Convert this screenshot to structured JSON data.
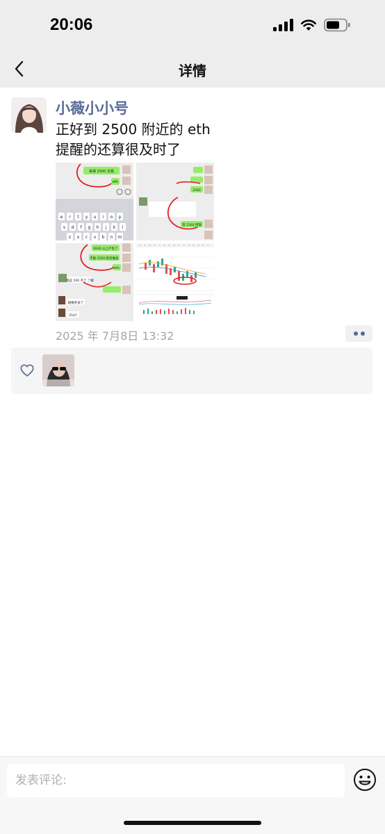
{
  "status_bar": {
    "time": "20:06"
  },
  "nav": {
    "title": "详情",
    "back_icon": "chevron-left-icon"
  },
  "post": {
    "author": "小薇小小号",
    "text_lines": [
      "正好到 2500 附近的 eth",
      "提醒的还算很及时了"
    ],
    "time": "2025 年 7月8日 13:32",
    "images": [
      {
        "name": "chat-screenshot-keyboard",
        "bubbles": [
          "来得 2500 交易",
          "eth"
        ],
        "keys": [
          "e",
          "r",
          "t",
          "y",
          "u",
          "i",
          "o",
          "p",
          "s",
          "d",
          "f",
          "g",
          "h",
          "j",
          "k",
          "l",
          "z",
          "x",
          "c",
          "v",
          "b",
          "n",
          "m"
        ]
      },
      {
        "name": "chat-screenshot-2",
        "bubbles": [
          "2560",
          "等 2500 回落"
        ]
      },
      {
        "name": "chat-screenshot-3",
        "bubbles": [
          "2640 以上产生了",
          "不能 2500 附近做多",
          "eth"
        ],
        "replies": [
          "到这 500 点了 了解",
          "刚要开多了",
          "2547"
        ]
      },
      {
        "name": "eth-price-chart",
        "bubbles": []
      }
    ]
  },
  "likes": {
    "icon": "heart-outline-icon",
    "count_shown": 1
  },
  "comment": {
    "placeholder": "发表评论:"
  },
  "colors": {
    "link": "#576b95",
    "bar_bg": "#ededed",
    "bubble_green": "#95ec69",
    "annotation_red": "#e02020"
  }
}
